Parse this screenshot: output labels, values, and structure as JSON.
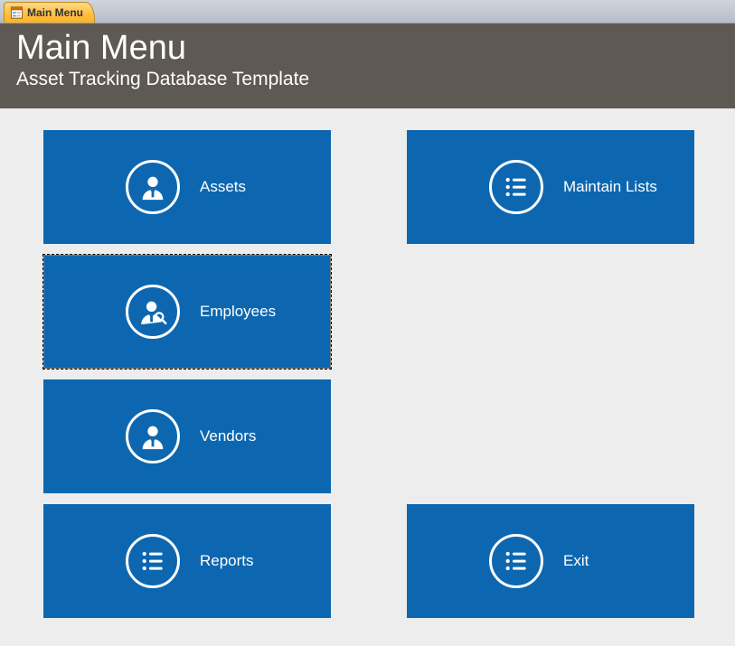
{
  "tab": {
    "label": "Main Menu"
  },
  "header": {
    "title": "Main Menu",
    "subtitle": "Asset Tracking Database Template"
  },
  "tiles": {
    "assets": {
      "label": "Assets"
    },
    "maintain": {
      "label": "Maintain Lists"
    },
    "employees": {
      "label": "Employees"
    },
    "vendors": {
      "label": "Vendors"
    },
    "reports": {
      "label": "Reports"
    },
    "exit": {
      "label": "Exit"
    }
  }
}
